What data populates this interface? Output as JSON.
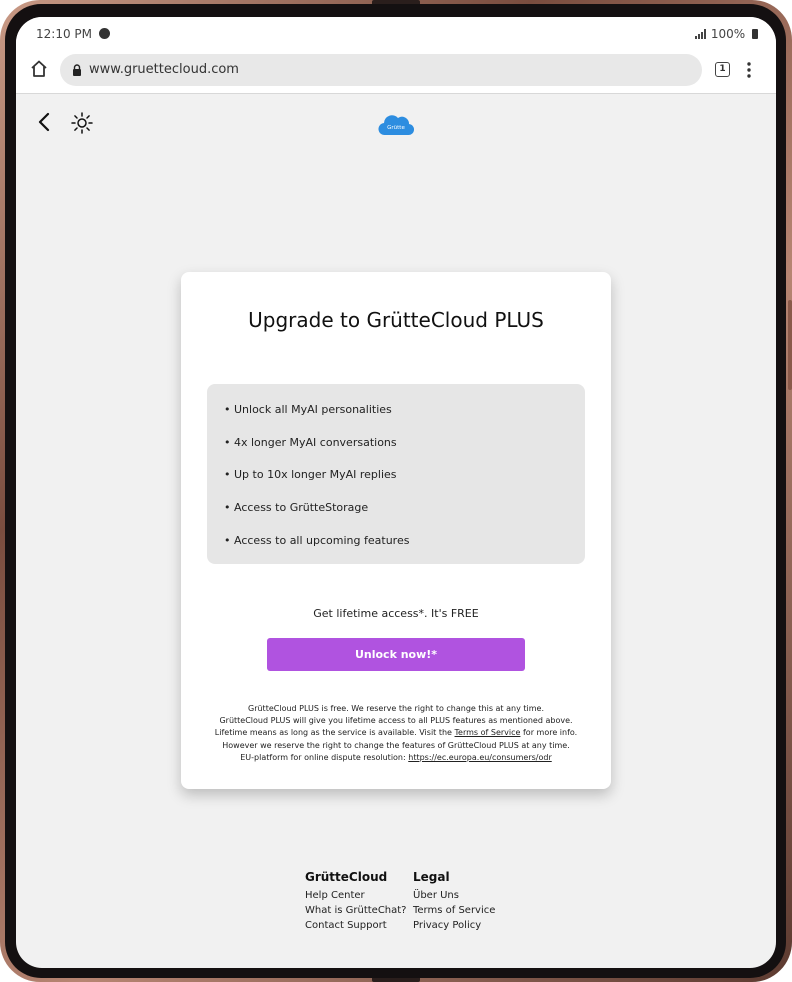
{
  "status_bar": {
    "time": "12:10 PM",
    "battery": "100%"
  },
  "browser": {
    "url": "www.gruettecloud.com",
    "tab_count": "1"
  },
  "header": {
    "logo_text": "Grütte"
  },
  "card": {
    "title": "Upgrade to GrütteCloud PLUS",
    "features": [
      "Unlock all MyAI personalities",
      "4x longer MyAI conversations",
      "Up to 10x longer MyAI replies",
      "Access to GrütteStorage",
      "Access to all upcoming features"
    ],
    "cta_text": "Get lifetime access*. It's FREE",
    "button_label": "Unlock now!*",
    "legal": {
      "line1": "GrütteCloud PLUS is free. We reserve the right to change this at any time.",
      "line2": "GrütteCloud PLUS will give you lifetime access to all PLUS features as mentioned above.",
      "line3_pre": "Lifetime means as long as the service is available. Visit the ",
      "line3_link": "Terms of Service",
      "line3_post": " for more info.",
      "line4": "However we reserve the right to change the features of GrütteCloud PLUS at any time.",
      "line5_pre": "EU-platform for online dispute resolution: ",
      "line5_link": "https://ec.europa.eu/consumers/odr"
    }
  },
  "footer": {
    "col1": {
      "heading": "GrütteCloud",
      "items": [
        "Help Center",
        "What is GrütteChat?",
        "Contact Support"
      ]
    },
    "col2": {
      "heading": "Legal",
      "items": [
        "Über Uns",
        "Terms of Service",
        "Privacy Policy"
      ]
    }
  },
  "colors": {
    "accent": "#b053e0",
    "page_bg": "#f1f1f1",
    "feature_box": "#e6e6e6",
    "logo": "#2d8de0"
  }
}
